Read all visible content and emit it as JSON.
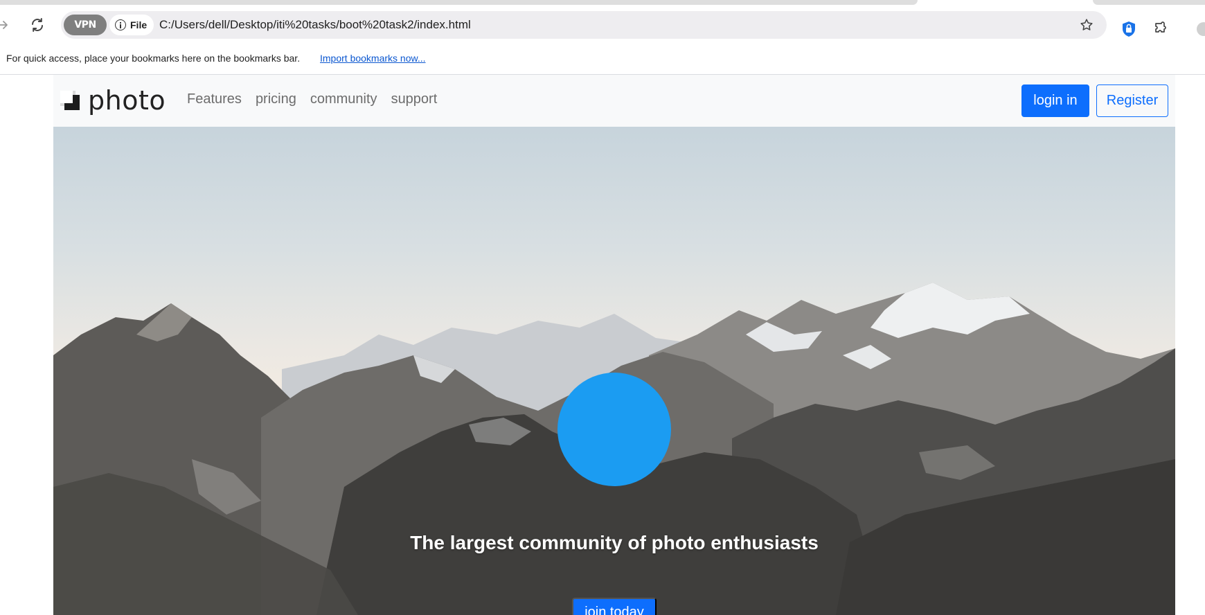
{
  "browser": {
    "address_bar": {
      "vpn_label": "VPN",
      "scheme_label": "File",
      "url": "C:/Users/dell/Desktop/iti%20tasks/boot%20task2/index.html"
    },
    "icons": {
      "forward": "arrow-right-icon",
      "reload": "reload-icon",
      "info": "info-icon",
      "bookmark": "star-icon",
      "extension_shield": "shield-icon",
      "extensions": "puzzle-icon"
    },
    "bookmarks_bar": {
      "message": "For quick access, place your bookmarks here on the bookmarks bar.",
      "import_link": "Import bookmarks now..."
    }
  },
  "site": {
    "brand": "photo",
    "nav_links": [
      "Features",
      "pricing",
      "community",
      "support"
    ],
    "login_label": "login in",
    "register_label": "Register",
    "hero": {
      "heading": "The largest community of photo enthusiasts",
      "cta_label": "join today"
    },
    "colors": {
      "primary": "#0d6efd",
      "circle": "#1b9cf2",
      "navbar_bg": "#f8f9fa"
    }
  }
}
